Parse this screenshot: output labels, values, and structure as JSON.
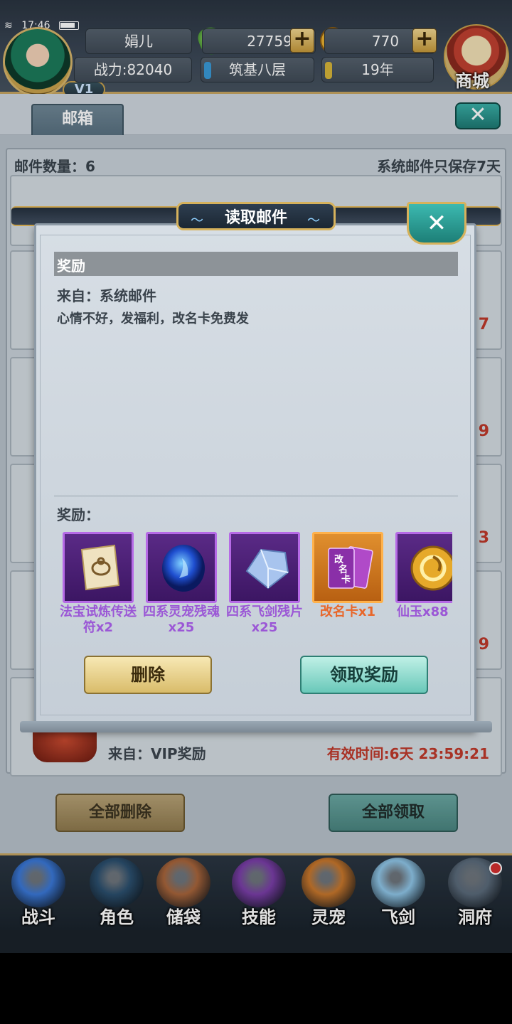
{
  "status_bar": {
    "time": "17:46"
  },
  "player": {
    "name": "娟儿",
    "power_text": "战力:82040",
    "vip": "V1",
    "jade": "27759",
    "gold": "770",
    "realm": "筑基八层",
    "age": "19年",
    "plus_symbol": "+"
  },
  "shop_label": "商城",
  "mailbox": {
    "tab": "邮箱",
    "close_symbol": "✕",
    "count_text": "邮件数量：6",
    "note_text": "系统邮件只保存7天",
    "partial_red_values": [
      "7",
      "9",
      "3",
      "9"
    ],
    "last_mail": {
      "from": "来自：VIP奖励",
      "expiry": "有效时间:6天 23:59:21"
    },
    "delete_all": "全部删除",
    "claim_all": "全部领取"
  },
  "modal": {
    "title": "读取邮件",
    "close_symbol": "✕",
    "subject": "奖励",
    "from": "来自：系统邮件",
    "content": "心情不好，发福利，改名卡免费发",
    "reward_label": "奖励：",
    "rewards": [
      {
        "name": "法宝试炼传送符x2",
        "rarity": "purple",
        "icon": "scroll-icon"
      },
      {
        "name": "四系灵宠残魂x25",
        "rarity": "purple",
        "icon": "blue-orb-icon"
      },
      {
        "name": "四系飞剑残片x25",
        "rarity": "purple",
        "icon": "crystal-shard-icon"
      },
      {
        "name": "改名卡x1",
        "rarity": "orange",
        "icon": "rename-card-icon",
        "card_text": "改名卡"
      },
      {
        "name": "仙玉x88",
        "rarity": "purple",
        "icon": "gold-token-icon"
      }
    ],
    "delete_button": "删除",
    "claim_button": "领取奖励"
  },
  "nav": [
    {
      "label": "战斗",
      "icon": "battle-icon",
      "color": "#3a78d8"
    },
    {
      "label": "角色",
      "icon": "character-icon",
      "color": "#2b4f6e"
    },
    {
      "label": "储袋",
      "icon": "bag-icon",
      "color": "#a8653b"
    },
    {
      "label": "技能",
      "icon": "skill-icon",
      "color": "#7a3ea8"
    },
    {
      "label": "灵宠",
      "icon": "pet-icon",
      "color": "#c8772c"
    },
    {
      "label": "飞剑",
      "icon": "flying-sword-icon",
      "color": "#8fc6e8"
    },
    {
      "label": "洞府",
      "icon": "cave-icon",
      "color": "#5a6a7a"
    }
  ],
  "colors": {
    "gold_border": "#c6a662",
    "purple_rarity": "#9b57d6",
    "orange_rarity": "#e8672a",
    "expiry_red": "#c0392b",
    "teal_button": "#69c8b9"
  }
}
